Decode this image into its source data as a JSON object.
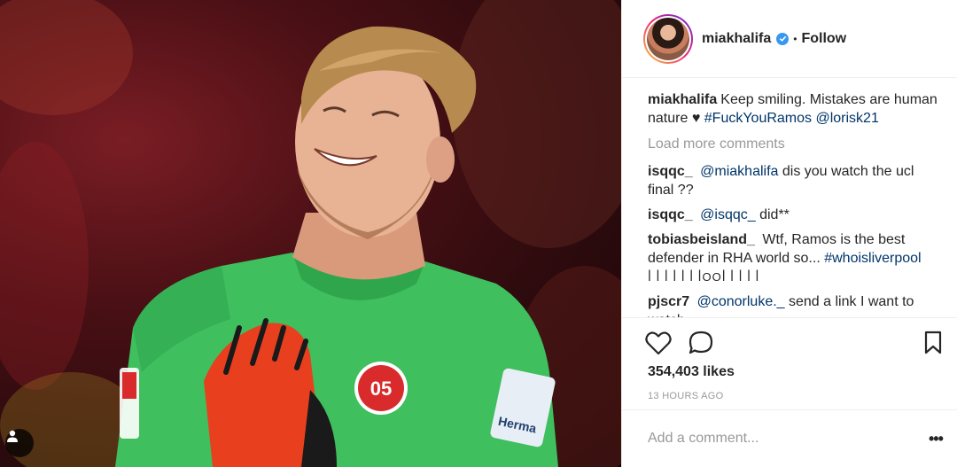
{
  "post": {
    "username": "miakhalifa",
    "follow_label": "Follow",
    "dot_separator": "•"
  },
  "caption": {
    "username": "miakhalifa",
    "text": "Keep smiling. Mistakes are human nature ♥ ",
    "hashtag": "#FuckYouRamos",
    "mention": "@lorisk21"
  },
  "load_more_label": "Load more comments",
  "comments": [
    {
      "username": "isqqc_",
      "mention": "@miakhalifa",
      "text": " dis you watch the ucl final ??"
    },
    {
      "username": "isqqc_",
      "mention": "@isqqc_",
      "text": " did**"
    },
    {
      "username": "tobiasbeisland_",
      "mention": "",
      "text": "Wtf, Ramos is the best defender in RHA world so... ",
      "hashtag": "#whoisliverpool",
      "extra": "ꟾ ꟾ ꟾ ꟾ ꟾ ꟾ ꟾOOꟾ ꟾ ꟾ ꟾ ꟾ"
    },
    {
      "username": "pjscr7",
      "mention": "@conorluke._",
      "text": " send a link I want to watch"
    }
  ],
  "likes": "354,403 likes",
  "timestamp": "13 HOURS AGO",
  "add_comment_placeholder": "Add a comment...",
  "more_options_label": "•••",
  "photo": {
    "crest_text": "05",
    "sponsor_text": "Herma"
  },
  "icons": {
    "like": "heart-icon",
    "comment": "comment-bubble-icon",
    "save": "bookmark-icon",
    "verified": "verified-badge-icon",
    "tag": "user-tag-icon"
  },
  "colors": {
    "jersey": "#3fbf5e",
    "glove": "#e8401f",
    "link": "#003569",
    "verified": "#3897f0",
    "muted": "#999999"
  }
}
